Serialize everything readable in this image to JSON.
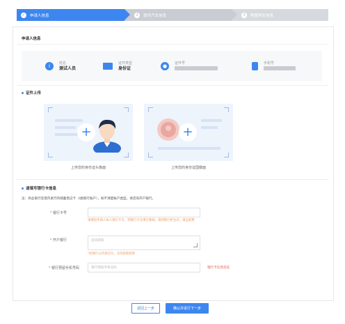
{
  "steps": [
    {
      "num": "✓",
      "label": "申请人信息"
    },
    {
      "num": "2",
      "label": "提供汽车信息"
    },
    {
      "num": "3",
      "label": "购置购车信息"
    }
  ],
  "applicant": {
    "section_title": "申请人信息",
    "name_label": "姓名",
    "name_value": "测试人员",
    "id_type_label": "证件类型",
    "id_type_value": "身份证",
    "id_no_label": "证件号",
    "phone_label": "手机号"
  },
  "upload": {
    "section_title": "证件上传",
    "front_caption": "上传您的身份证头像面",
    "back_caption": "上传您的身份证国徽面"
  },
  "bank": {
    "section_title": "请填写银行卡信息",
    "note": "注：商业银行在借内发行的储蓄借记卡（I类银行账户），如不清楚账户类型，请咨询开户银行。",
    "card_label": "银行卡号",
    "card_hint": "请填您申请人本人银行卡号，到银行卡号填写要规，请到银行柜台开，请自卸费",
    "bank_label": "开户银行",
    "bank_placeholder": "自动获取",
    "bank_hint": "*此银行以待查记号，号码获取后修",
    "phone_label": "银行预留手机号码",
    "phone_placeholder": "银行预留手机号码",
    "phone_link": "银行卡信息验证"
  },
  "buttons": {
    "prev": "返回上一步",
    "next": "确认并进行下一步"
  },
  "colors": {
    "primary": "#3d86f0",
    "warning": "#f09a63",
    "required": "#e8604a"
  }
}
